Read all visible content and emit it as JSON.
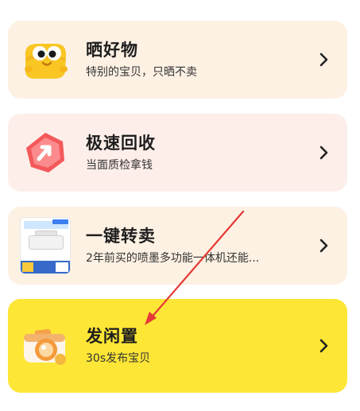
{
  "cards": [
    {
      "title": "晒好物",
      "subtitle": "特别的宝贝，只晒不卖",
      "icon": "mascot-icon"
    },
    {
      "title": "极速回收",
      "subtitle": "当面质检拿钱",
      "icon": "recycle-arrow-icon"
    },
    {
      "title": "一键转卖",
      "subtitle": "2年前买的喷墨多功能一体机还能...",
      "icon": "product-thumbnail"
    },
    {
      "title": "发闲置",
      "subtitle": "30s发布宝贝",
      "icon": "camera-icon"
    }
  ],
  "colors": {
    "card1_bg": "#fdf1e4",
    "card2_bg": "#fdeee9",
    "card3_bg": "#fdf1e3",
    "card4_bg": "#fde635",
    "annotation_arrow": "#e53935"
  }
}
